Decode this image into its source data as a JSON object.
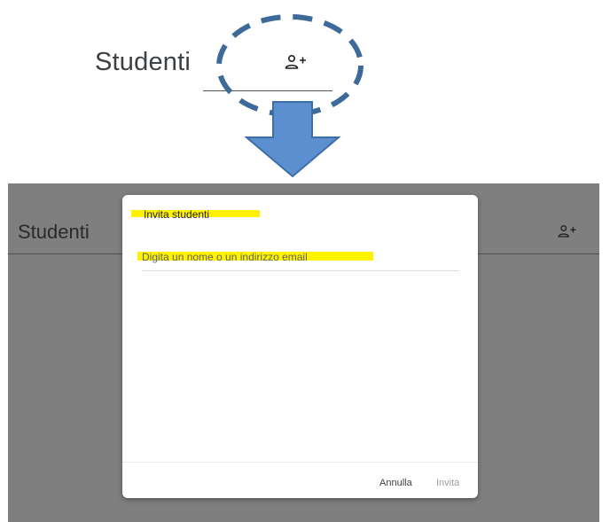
{
  "callout": {
    "title": "Studenti",
    "add_icon": "person-add-icon"
  },
  "background_page": {
    "title": "Studenti",
    "add_icon": "person-add-icon"
  },
  "dialog": {
    "title": "Invita studenti",
    "input": {
      "value": "",
      "placeholder": "Digita un nome o un indirizzo email"
    },
    "cancel_label": "Annulla",
    "invite_label": "Invita"
  },
  "colors": {
    "callout_circle": "#3d6a98",
    "arrow": "#5b8fd0",
    "highlight": "#fff200",
    "overlay": "#7f7f7f"
  }
}
